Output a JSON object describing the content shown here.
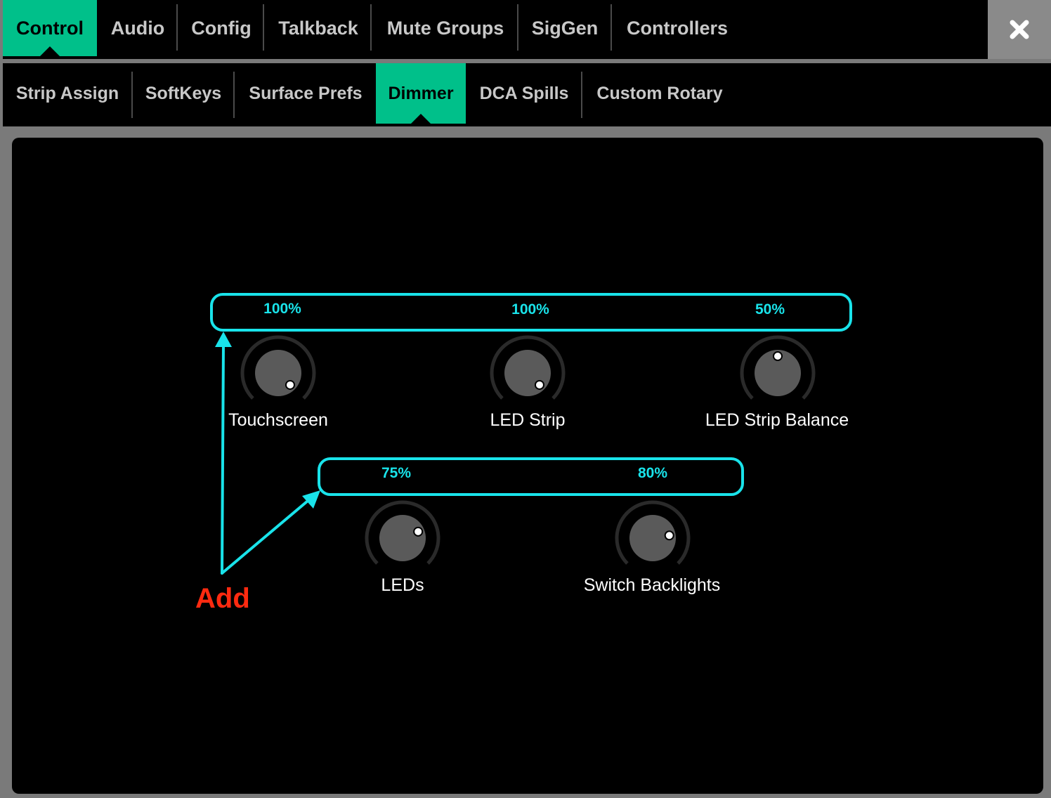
{
  "top_tabs": [
    {
      "label": "Control",
      "active": true
    },
    {
      "label": "Audio",
      "active": false
    },
    {
      "label": "Config",
      "active": false
    },
    {
      "label": "Talkback",
      "active": false
    },
    {
      "label": "Mute Groups",
      "active": false
    },
    {
      "label": "SigGen",
      "active": false
    },
    {
      "label": "Controllers",
      "active": false
    }
  ],
  "sub_tabs": [
    {
      "label": "Strip Assign",
      "active": false
    },
    {
      "label": "SoftKeys",
      "active": false
    },
    {
      "label": "Surface Prefs",
      "active": false
    },
    {
      "label": "Dimmer",
      "active": true
    },
    {
      "label": "DCA Spills",
      "active": false
    },
    {
      "label": "Custom Rotary",
      "active": false
    }
  ],
  "close_icon": "close-icon",
  "dimmers": {
    "row1": [
      {
        "label": "Touchscreen",
        "value_text": "100%",
        "value": 100
      },
      {
        "label": "LED Strip",
        "value_text": "100%",
        "value": 100
      },
      {
        "label": "LED Strip Balance",
        "value_text": "50%",
        "value": 50
      }
    ],
    "row2": [
      {
        "label": "LEDs",
        "value_text": "75%",
        "value": 75
      },
      {
        "label": "Switch Backlights",
        "value_text": "80%",
        "value": 80
      }
    ]
  },
  "annotation": {
    "text": "Add",
    "color": "#ff2a10",
    "arrow_color": "#19e3ea"
  },
  "colors": {
    "accent": "#00c08a",
    "highlight": "#19e3ea"
  }
}
